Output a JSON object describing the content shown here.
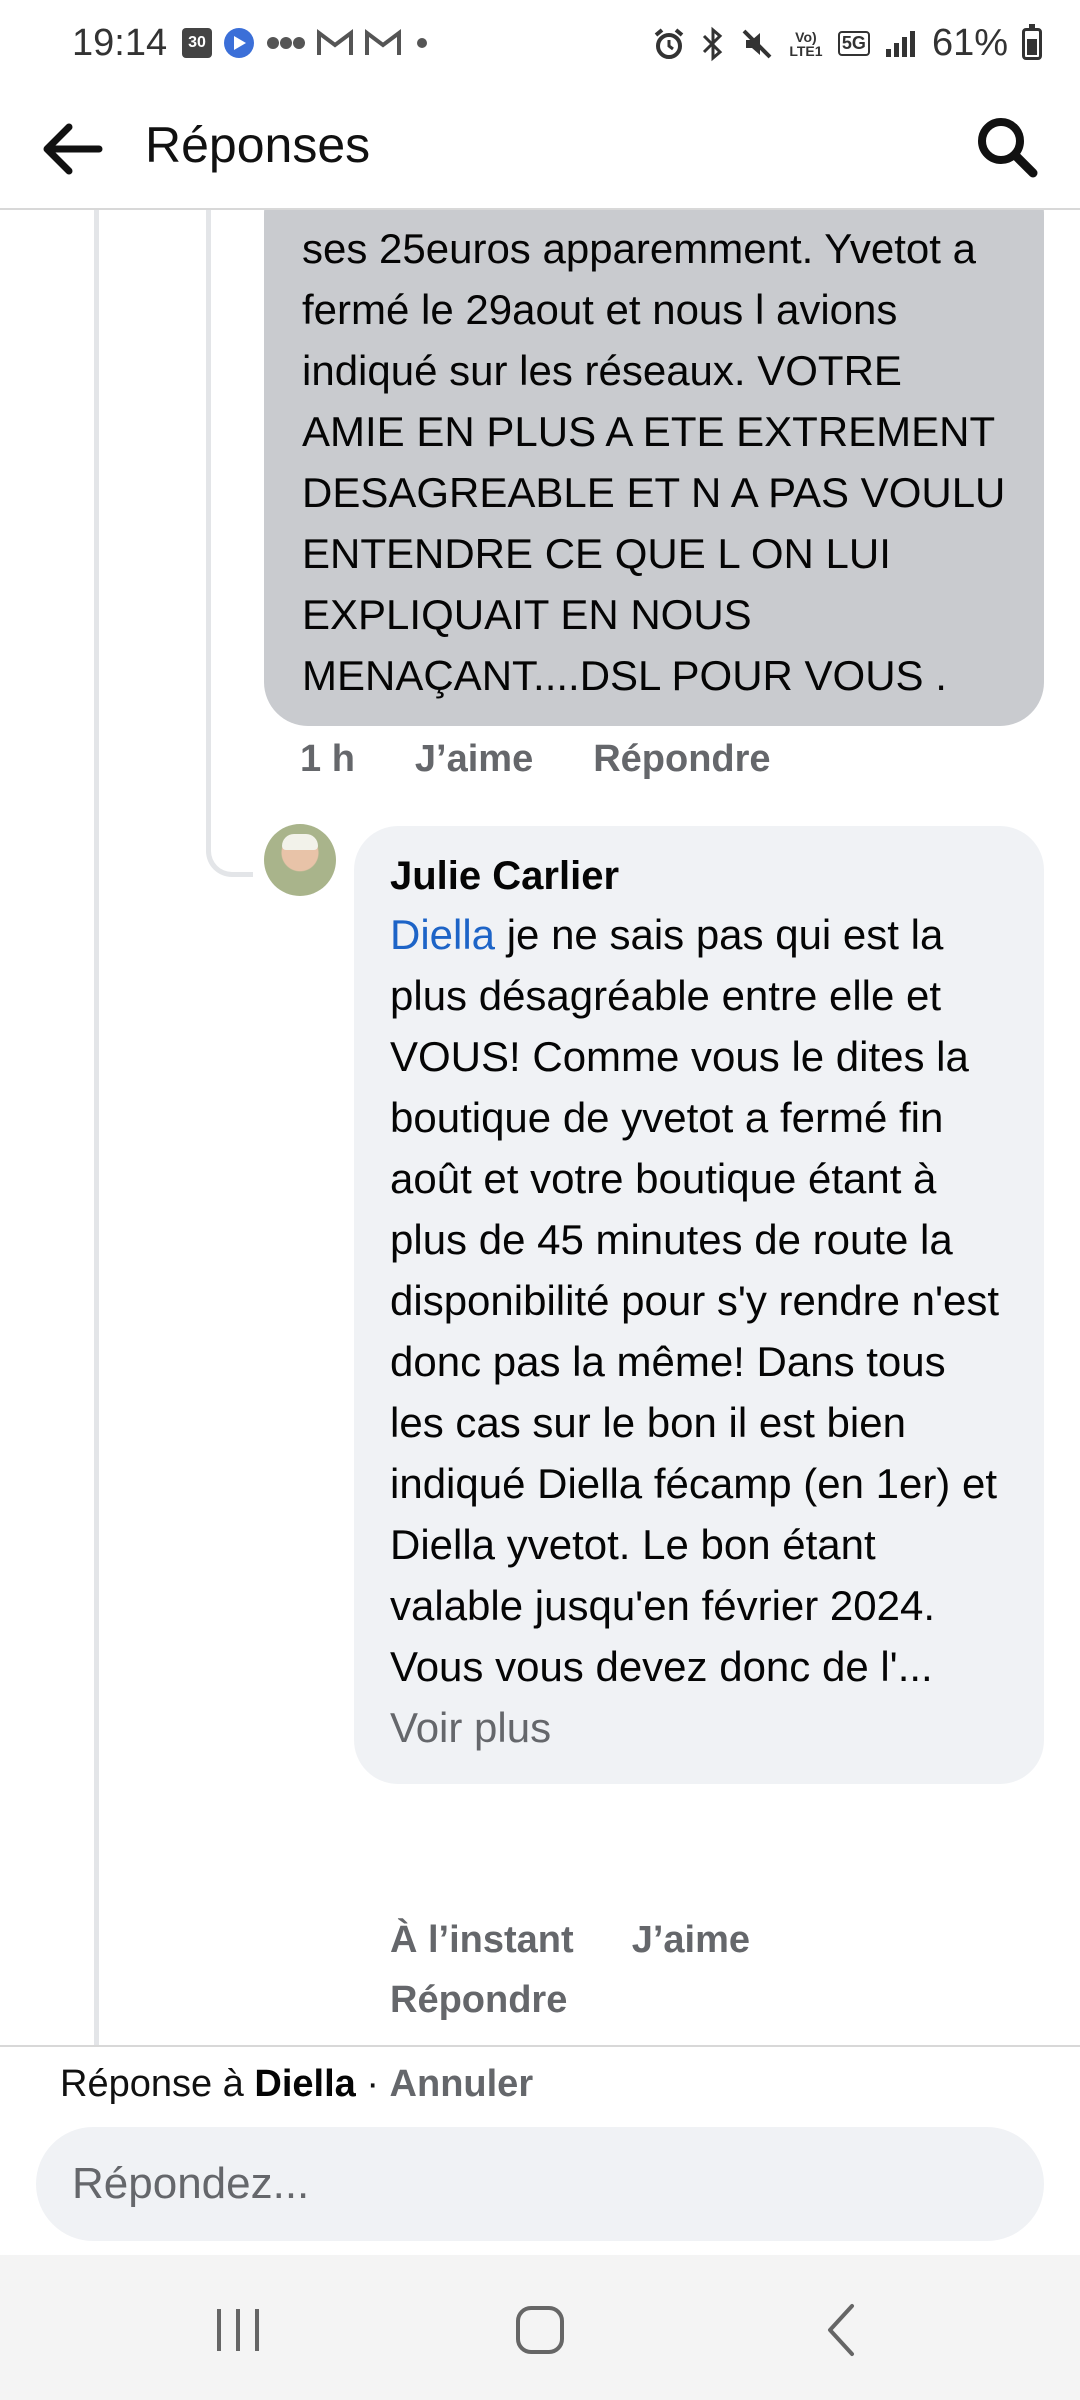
{
  "status_bar": {
    "time": "19:14",
    "calendar_day": "30",
    "battery_percent": "61%",
    "network_label": "5G",
    "volte_label": "Vo) LTE1"
  },
  "header": {
    "title": "Réponses"
  },
  "comments": [
    {
      "text": "ses 25euros apparemment. Yvetot a fermé le 29aout et nous l avions indiqué sur les réseaux. VOTRE AMIE EN PLUS A ETE EXTREMENT DESAGREABLE ET N A PAS VOULU ENTENDRE CE QUE L ON LUI EXPLIQUAIT EN NOUS MENAÇANT....DSL POUR VOUS .",
      "time": "1 h",
      "like_label": "J’aime",
      "reply_label": "Répondre"
    },
    {
      "author": "Julie Carlier",
      "mention": "Diella",
      "text": " je ne sais pas qui est la plus désagréable entre elle et VOUS! Comme vous le dites la boutique de yvetot a fermé fin août et votre boutique étant à plus de 45 minutes de route la disponibilité pour s'y rendre n'est donc pas la même! Dans tous les cas sur le bon il est bien indiqué Diella fécamp (en 1er) et Diella yvetot. Le bon étant valable jusqu'en février 2024. Vous vous devez donc de l'... ",
      "see_more": "Voir plus",
      "time": "À l’instant",
      "like_label": "J’aime",
      "reply_label": "Répondre"
    }
  ],
  "reply_bar": {
    "prefix": "Réponse à ",
    "target": "Diella",
    "separator": " · ",
    "cancel_label": "Annuler",
    "placeholder": "Répondez..."
  },
  "icons": {
    "back": "arrow-left-icon",
    "search": "search-icon",
    "nav_recent": "recent-apps-icon",
    "nav_home": "home-icon",
    "nav_back": "nav-back-icon"
  },
  "colors": {
    "mention_blue": "#1d64c7",
    "bubble_gray_dark": "#c9cbcf",
    "bubble_gray_light": "#f0f2f5",
    "meta_gray": "#65676b"
  }
}
